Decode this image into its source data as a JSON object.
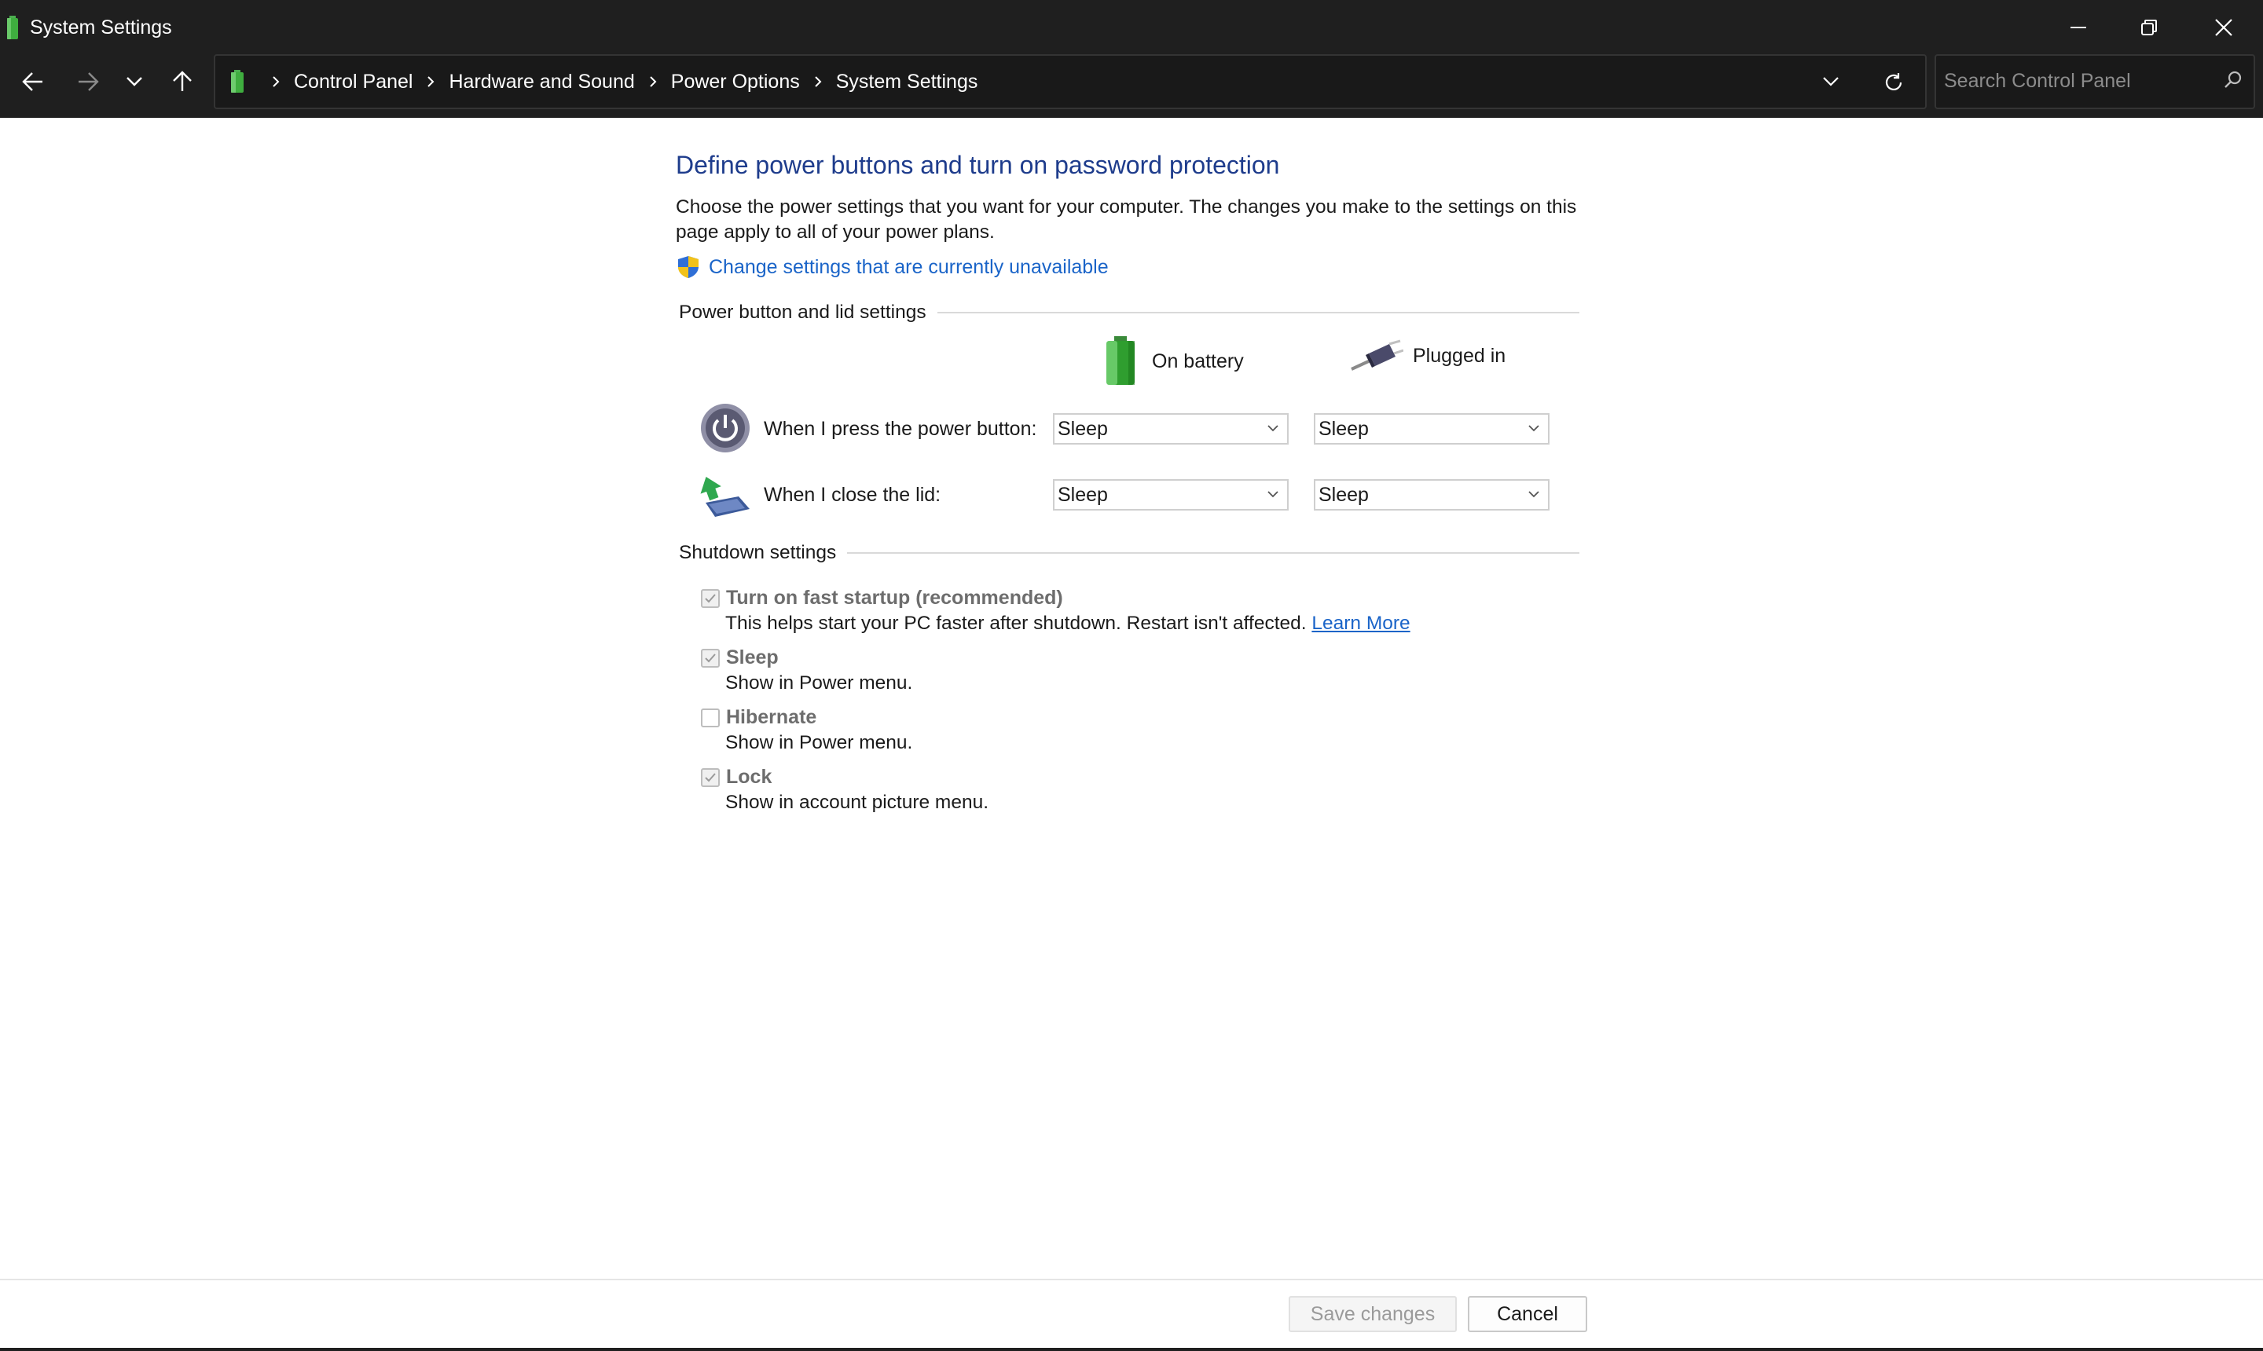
{
  "window": {
    "title": "System Settings",
    "minimize": "minimize-icon",
    "maximize": "restore-icon",
    "close": "close-icon"
  },
  "nav": {
    "back": "back-arrow-icon",
    "forward": "forward-arrow-icon",
    "recent": "chevron-down-icon",
    "up": "up-arrow-icon"
  },
  "address": {
    "crumbs": [
      "Control Panel",
      "Hardware and Sound",
      "Power Options",
      "System Settings"
    ]
  },
  "search": {
    "placeholder": "Search Control Panel"
  },
  "page": {
    "heading": "Define power buttons and turn on password protection",
    "description": "Choose the power settings that you want for your computer. The changes you make to the settings on this page apply to all of your power plans.",
    "unavailable_link": "Change settings that are currently unavailable"
  },
  "power_section": {
    "title": "Power button and lid settings",
    "col_battery": "On battery",
    "col_plugged": "Plugged in",
    "rows": [
      {
        "label": "When I press the power button:",
        "battery": "Sleep",
        "plugged": "Sleep"
      },
      {
        "label": "When I close the lid:",
        "battery": "Sleep",
        "plugged": "Sleep"
      }
    ]
  },
  "shutdown_section": {
    "title": "Shutdown settings",
    "items": [
      {
        "title": "Turn on fast startup (recommended)",
        "subtitle": "This helps start your PC faster after shutdown. Restart isn't affected.",
        "link": "Learn More",
        "checked": true
      },
      {
        "title": "Sleep",
        "subtitle": "Show in Power menu.",
        "checked": true
      },
      {
        "title": "Hibernate",
        "subtitle": "Show in Power menu.",
        "checked": false
      },
      {
        "title": "Lock",
        "subtitle": "Show in account picture menu.",
        "checked": true
      }
    ]
  },
  "footer": {
    "save": "Save changes",
    "cancel": "Cancel"
  },
  "colors": {
    "heading": "#1e3c8c",
    "link": "#1a64c8",
    "titlebar": "#1f1f1f"
  }
}
